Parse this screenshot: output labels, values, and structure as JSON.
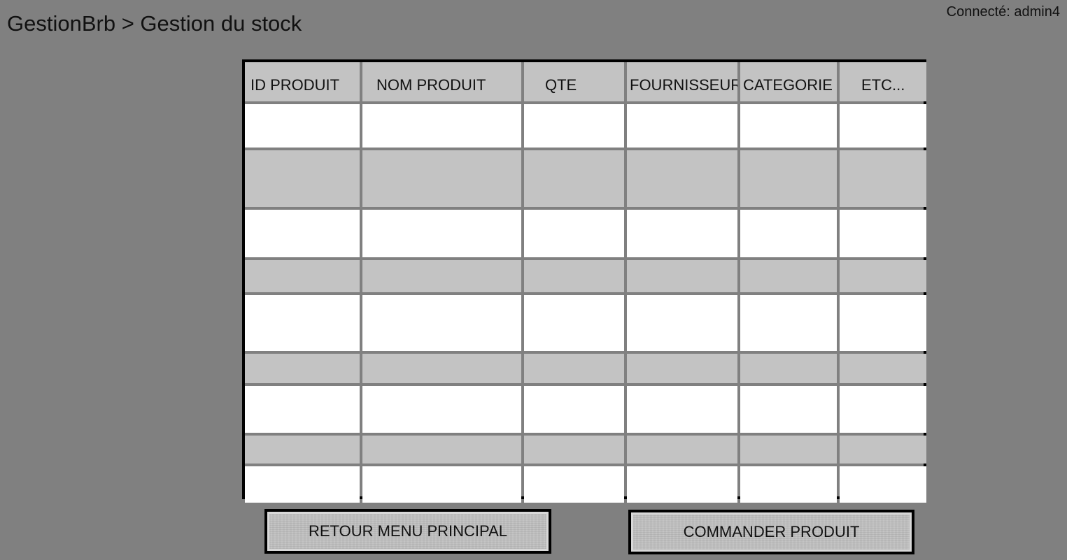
{
  "header": {
    "breadcrumb": "GestionBrb > Gestion du stock",
    "user_status": "Connecté: admin4"
  },
  "table": {
    "columns": [
      "ID PRODUIT",
      "NOM PRODUIT",
      "QTE",
      "FOURNISSEUR",
      "CATEGORIE",
      "ETC..."
    ],
    "rows": [
      [
        "",
        "",
        "",
        "",
        "",
        ""
      ],
      [
        "",
        "",
        "",
        "",
        "",
        ""
      ],
      [
        "",
        "",
        "",
        "",
        "",
        ""
      ],
      [
        "",
        "",
        "",
        "",
        "",
        ""
      ],
      [
        "",
        "",
        "",
        "",
        "",
        ""
      ],
      [
        "",
        "",
        "",
        "",
        "",
        ""
      ],
      [
        "",
        "",
        "",
        "",
        "",
        ""
      ],
      [
        "",
        "",
        "",
        "",
        "",
        ""
      ],
      [
        "",
        "",
        "",
        "",
        "",
        ""
      ]
    ]
  },
  "buttons": {
    "back_label": "RETOUR MENU PRINCIPAL",
    "order_label": "COMMANDER PRODUIT"
  }
}
